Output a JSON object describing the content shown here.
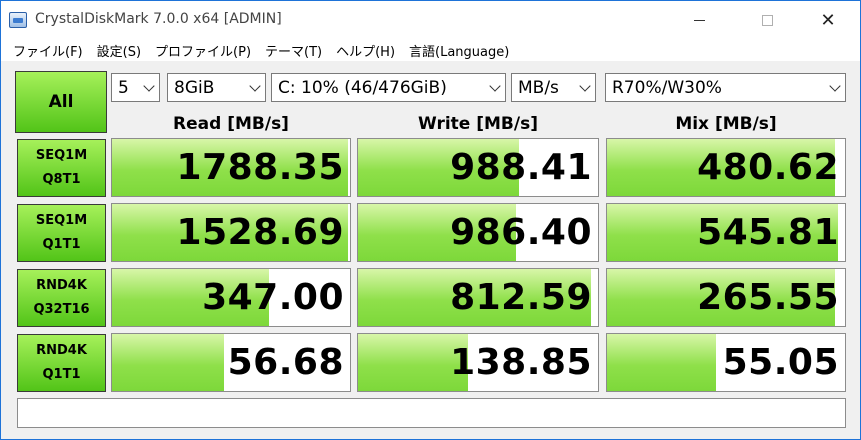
{
  "window": {
    "title": "CrystalDiskMark 7.0.0 x64 [ADMIN]"
  },
  "menu": [
    "ファイル(F)",
    "設定(S)",
    "プロファイル(P)",
    "テーマ(T)",
    "ヘルプ(H)",
    "言語(Language)"
  ],
  "controls": {
    "all_label": "All",
    "count": "5",
    "size": "8GiB",
    "drive": "C: 10% (46/476GiB)",
    "unit": "MB/s",
    "mix_ratio": "R70%/W30%"
  },
  "columns": {
    "read": "Read [MB/s]",
    "write": "Write [MB/s]",
    "mix": "Mix [MB/s]"
  },
  "rows": [
    {
      "line1": "SEQ1M",
      "line2": "Q8T1",
      "read": "1788.35",
      "write": "988.41",
      "mix": "480.62"
    },
    {
      "line1": "SEQ1M",
      "line2": "Q1T1",
      "read": "1528.69",
      "write": "986.40",
      "mix": "545.81"
    },
    {
      "line1": "RND4K",
      "line2": "Q32T16",
      "read": "347.00",
      "write": "812.59",
      "mix": "265.55"
    },
    {
      "line1": "RND4K",
      "line2": "Q1T1",
      "read": "56.68",
      "write": "138.85",
      "mix": "55.05"
    }
  ],
  "bar_fill": [
    {
      "read": 0.99,
      "write": 0.67,
      "mix": 0.96
    },
    {
      "read": 0.99,
      "write": 0.66,
      "mix": 0.97
    },
    {
      "read": 0.66,
      "write": 0.97,
      "mix": 0.96
    },
    {
      "read": 0.47,
      "write": 0.46,
      "mix": 0.46
    }
  ],
  "comment": ""
}
